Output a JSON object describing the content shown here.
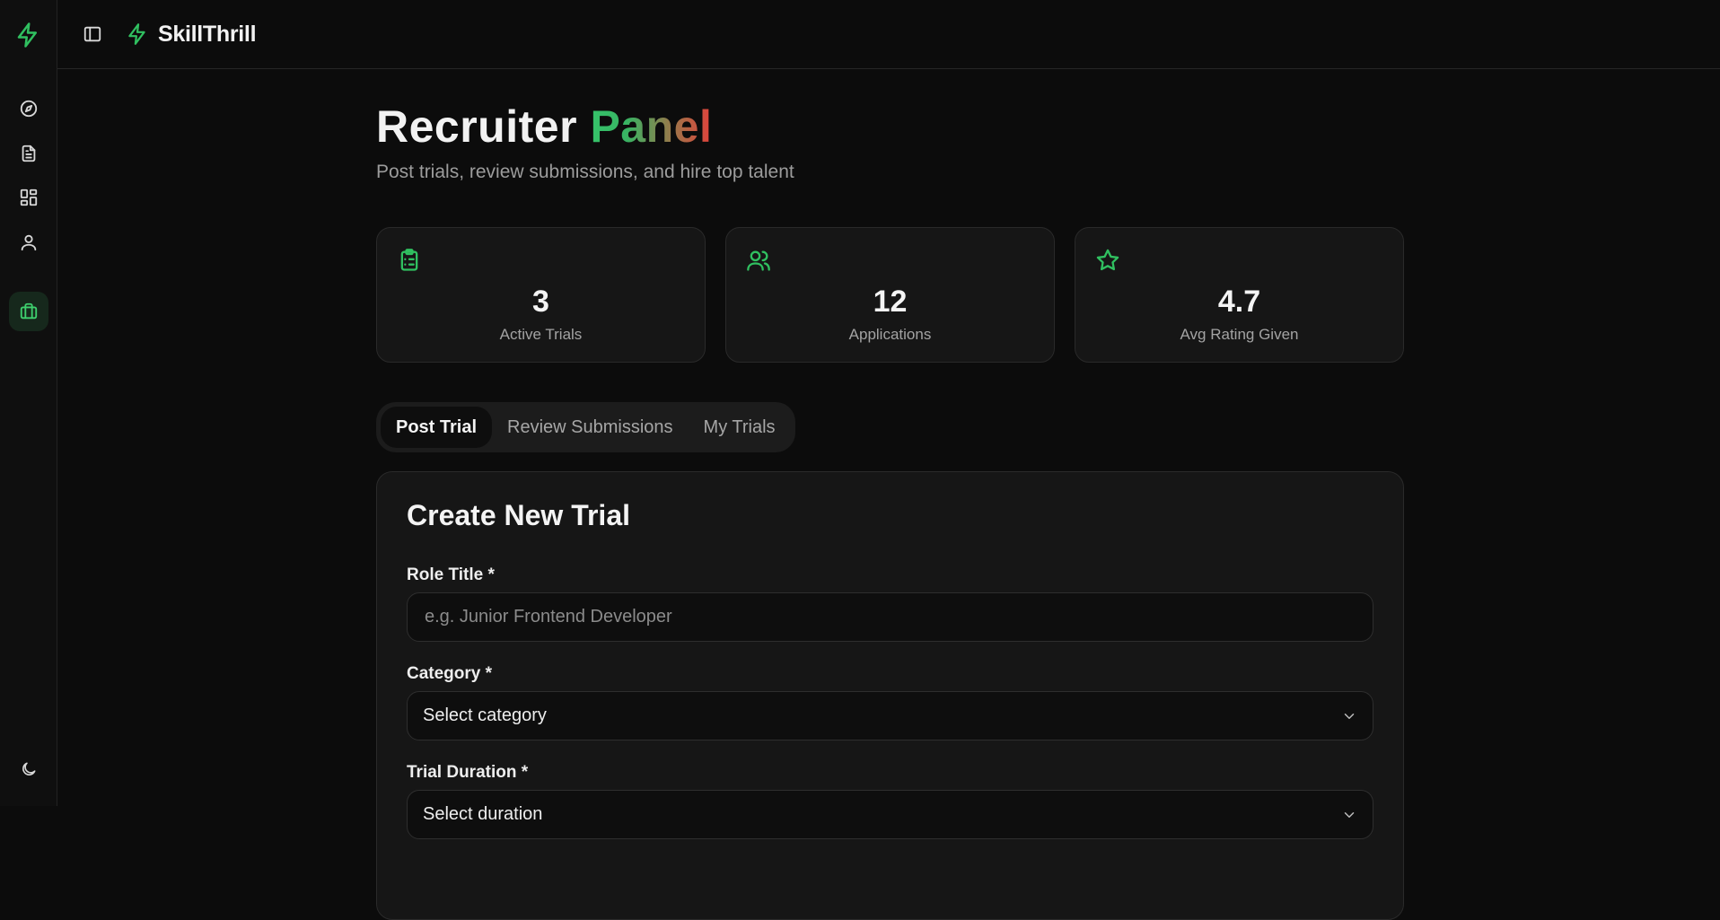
{
  "brand": {
    "name": "SkillThrill",
    "accent": "#30c060"
  },
  "rail": {
    "items": [
      {
        "icon": "compass-icon",
        "label": "Explore"
      },
      {
        "icon": "file-text-icon",
        "label": "Documents"
      },
      {
        "icon": "dashboard-icon",
        "label": "Dashboard"
      },
      {
        "icon": "user-icon",
        "label": "Profile"
      },
      {
        "icon": "briefcase-icon",
        "label": "Recruiter",
        "active": true
      }
    ],
    "bottom_icon": "moon-icon"
  },
  "page": {
    "title_plain": "Recruiter ",
    "title_highlight": "Panel",
    "subtitle": "Post trials, review submissions, and hire top talent"
  },
  "stats": [
    {
      "icon": "clipboard-list-icon",
      "value": "3",
      "label": "Active Trials"
    },
    {
      "icon": "users-icon",
      "value": "12",
      "label": "Applications"
    },
    {
      "icon": "star-icon",
      "value": "4.7",
      "label": "Avg Rating Given"
    }
  ],
  "tabs": [
    {
      "label": "Post Trial",
      "active": true
    },
    {
      "label": "Review Submissions",
      "active": false
    },
    {
      "label": "My Trials",
      "active": false
    }
  ],
  "form": {
    "title": "Create New Trial",
    "role_title": {
      "label": "Role Title *",
      "placeholder": "e.g. Junior Frontend Developer"
    },
    "category": {
      "label": "Category *",
      "value": "Select category"
    },
    "duration": {
      "label": "Trial Duration *",
      "value": "Select duration"
    }
  }
}
